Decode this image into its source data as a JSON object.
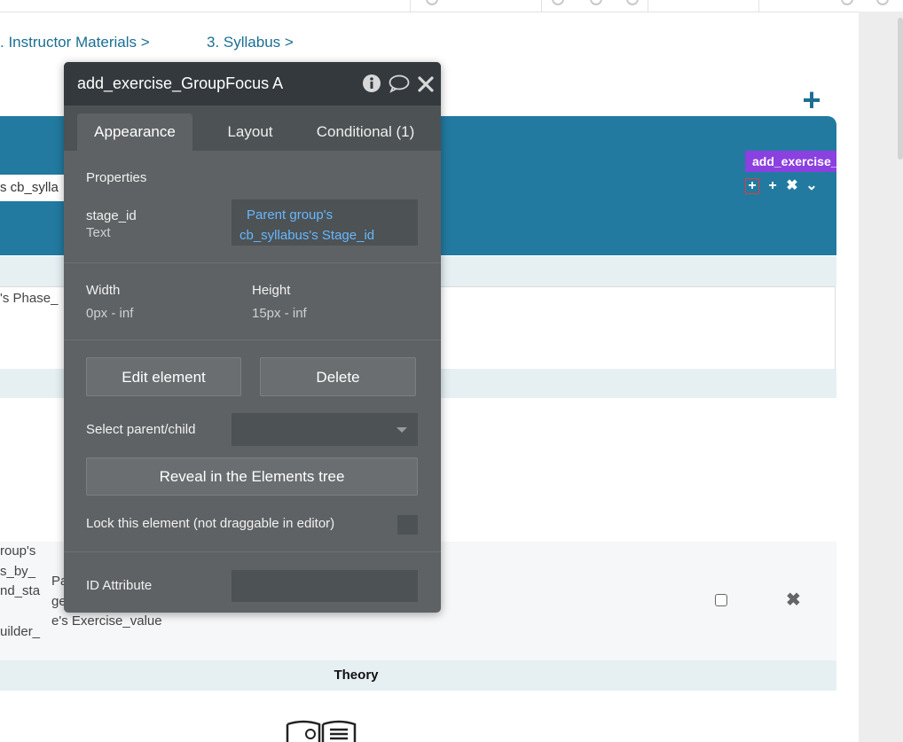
{
  "breadcrumb": {
    "items": [
      ". Instructor Materials >",
      "3. Syllabus >"
    ]
  },
  "canvas": {
    "search_fragment": "s cb_sylla",
    "tag_label": "add_exercise_",
    "phase_fragment": "'s Phase_",
    "left_fragments": [
      "roup's",
      "s_by_",
      "nd_sta",
      "uilder_"
    ],
    "mid_fragments": [
      "Pa",
      "ge"
    ],
    "exercise_value": "e's Exercise_value",
    "theory_label": "Theory"
  },
  "dialog": {
    "title": "add_exercise_GroupFocus A",
    "tabs": [
      "Appearance",
      "Layout",
      "Conditional (1)"
    ],
    "properties_heading": "Properties",
    "property_name": "stage_id",
    "property_type": "Text",
    "property_value_line1": "Parent group's",
    "property_value_line2": "cb_syllabus's Stage_id",
    "width_label": "Width",
    "width_value": "0px - inf",
    "height_label": "Height",
    "height_value": "15px - inf",
    "edit_button": "Edit element",
    "delete_button": "Delete",
    "select_parent_label": "Select parent/child",
    "reveal_button": "Reveal in the Elements tree",
    "lock_label": "Lock this element (not draggable in editor)",
    "id_attribute_label": "ID Attribute"
  },
  "colors": {
    "brand_blue": "#227aa0",
    "link_blue": "#1a6f93",
    "tag_purple": "#8b40e0",
    "dialog_bg": "#5e6264",
    "dialog_header": "#33393d",
    "expression_text": "#67b7ff"
  },
  "icons": {
    "header_add": "plus-icon",
    "dialog_info": "info-icon",
    "dialog_comment": "comment-icon",
    "dialog_close": "close-icon",
    "mini_toolbar": [
      "plus-icon",
      "plus-icon",
      "close-icon",
      "chevron-down-icon"
    ],
    "theory_illustration": "book-icon"
  }
}
